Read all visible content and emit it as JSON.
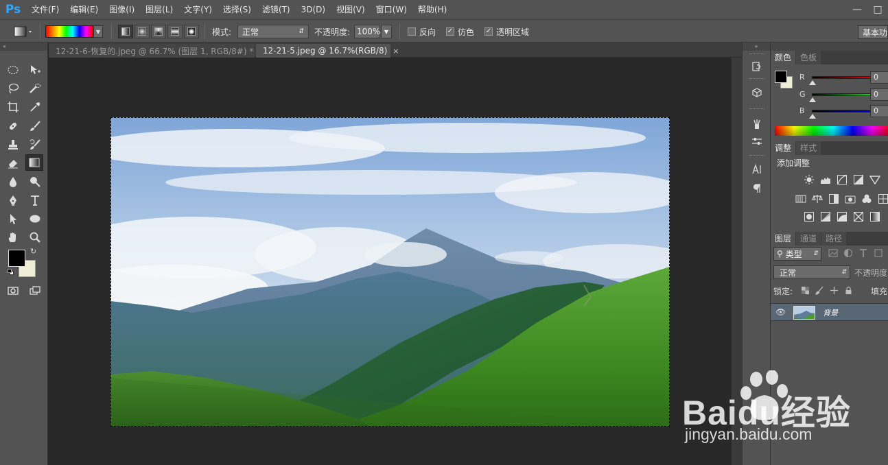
{
  "app": {
    "logo": "Ps",
    "menu": [
      "文件(F)",
      "编辑(E)",
      "图像(I)",
      "图层(L)",
      "文字(Y)",
      "选择(S)",
      "滤镜(T)",
      "3D(D)",
      "视图(V)",
      "窗口(W)",
      "帮助(H)"
    ]
  },
  "options": {
    "mode_label": "模式:",
    "mode_value": "正常",
    "opacity_label": "不透明度:",
    "opacity_value": "100%",
    "reverse_label": "反向",
    "reverse_checked": false,
    "dither_label": "仿色",
    "dither_checked": true,
    "transparency_label": "透明区域",
    "transparency_checked": true,
    "workspace_label": "基本功能",
    "gradient_colors": [
      "#ff0000",
      "#ffff00",
      "#00ff00",
      "#00ffff",
      "#0000ff",
      "#ff00ff"
    ]
  },
  "tabs": [
    {
      "label": "12-21-6-恢复的.jpeg @ 66.7% (图层 1, RGB/8#) *",
      "active": false
    },
    {
      "label": "12-21-5.jpeg @ 16.7%(RGB/8)",
      "active": true
    }
  ],
  "tools": {
    "foreground_color": "#000000",
    "background_color": "#f0edd6",
    "active_tool": "gradient-tool"
  },
  "color_panel": {
    "tabs": [
      "颜色",
      "色板"
    ],
    "active_tab": "颜色",
    "sliders": [
      {
        "label": "R",
        "value": "0",
        "color": "#ff0000"
      },
      {
        "label": "G",
        "value": "0",
        "color": "#00ff00"
      },
      {
        "label": "B",
        "value": "0",
        "color": "#0000ff"
      }
    ]
  },
  "adjustments_panel": {
    "tabs": [
      "调整",
      "样式"
    ],
    "active_tab": "调整",
    "heading": "添加调整"
  },
  "layers_panel": {
    "tabs": [
      "图层",
      "通道",
      "路径"
    ],
    "active_tab": "图层",
    "filter_label": "类型",
    "blend_mode": "正常",
    "opacity_label": "不透明度",
    "lock_label": "锁定:",
    "fill_label": "填充",
    "layers": [
      {
        "name": "背景",
        "visible": true,
        "selected": true
      }
    ]
  },
  "watermark": {
    "brand": "Baidu经验",
    "url": "jingyan.baidu.com"
  }
}
